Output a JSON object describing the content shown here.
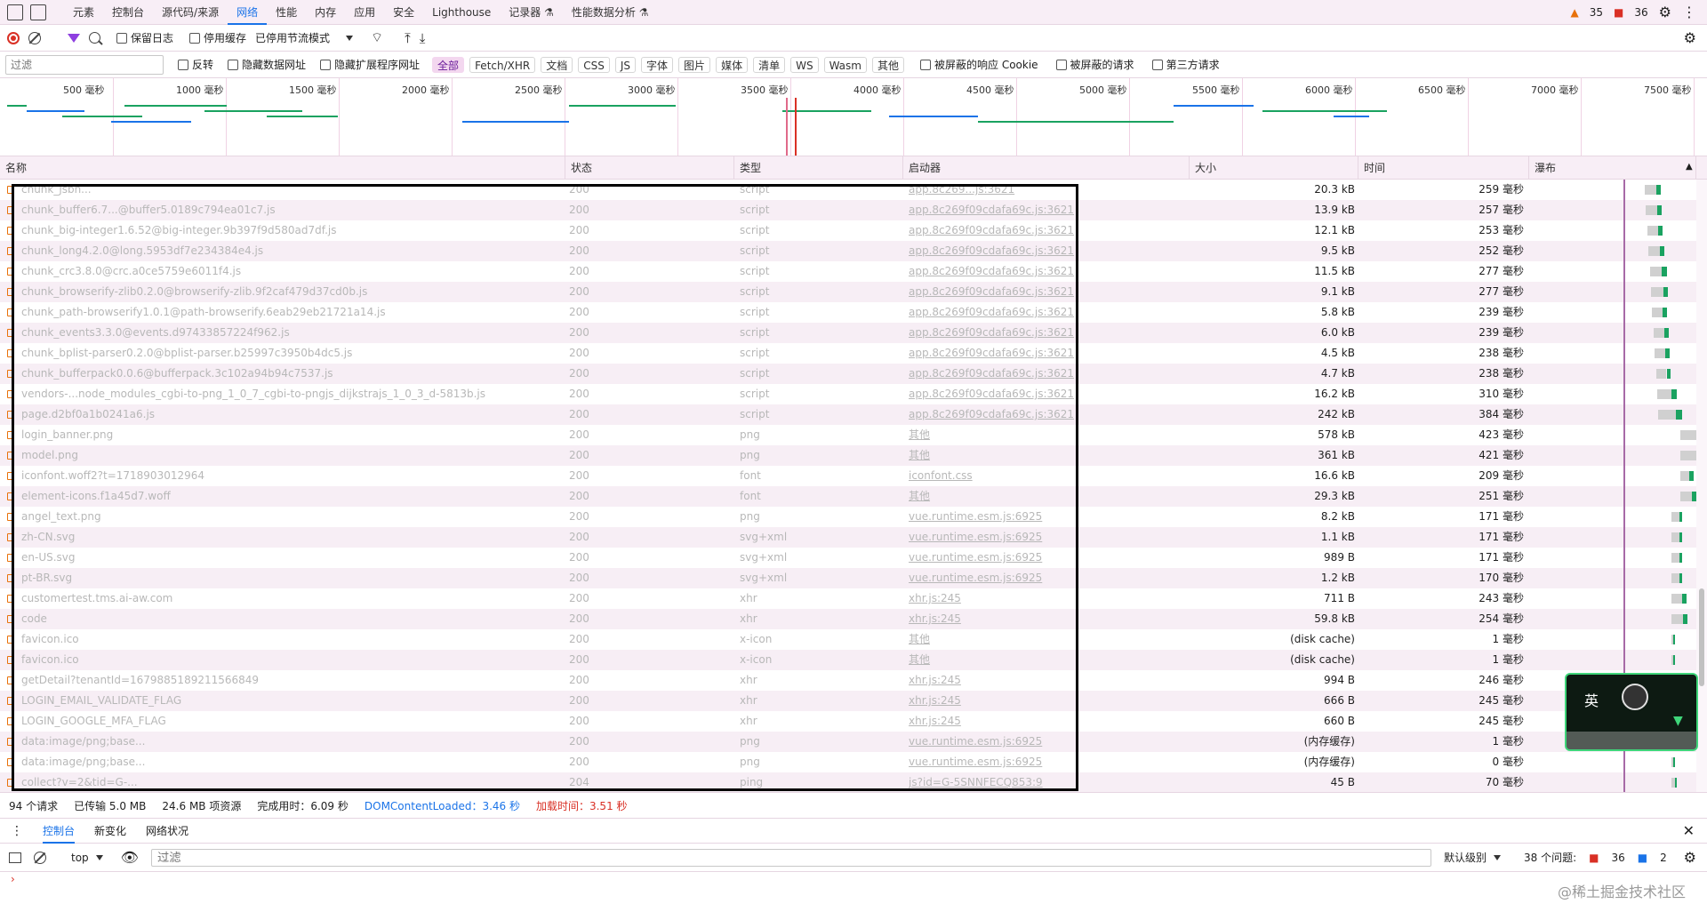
{
  "tabs": {
    "items": [
      "元素",
      "控制台",
      "源代码/来源",
      "网络",
      "性能",
      "内存",
      "应用",
      "安全",
      "Lighthouse",
      "记录器 ⚗",
      "性能数据分析 ⚗"
    ],
    "warnings": "35",
    "errors": "36"
  },
  "toolbar": {
    "preserve_log": "保留日志",
    "disable_cache": "停用缓存",
    "throttling": "已停用节流模式"
  },
  "filter": {
    "placeholder": "过滤",
    "invert": "反转",
    "hide_data_urls": "隐藏数据网址",
    "hide_ext_urls": "隐藏扩展程序网址",
    "types": [
      "全部",
      "Fetch/XHR",
      "文档",
      "CSS",
      "JS",
      "字体",
      "图片",
      "媒体",
      "清单",
      "WS",
      "Wasm",
      "其他"
    ],
    "blocked_cookies": "被屏蔽的响应 Cookie",
    "blocked_requests": "被屏蔽的请求",
    "third_party": "第三方请求"
  },
  "overview": {
    "ticks": [
      "500 毫秒",
      "1000 毫秒",
      "1500 毫秒",
      "2000 毫秒",
      "2500 毫秒",
      "3000 毫秒",
      "3500 毫秒",
      "4000 毫秒",
      "4500 毫秒",
      "5000 毫秒",
      "5500 毫秒",
      "6000 毫秒",
      "6500 毫秒",
      "7000 毫秒",
      "7500 毫秒"
    ]
  },
  "columns": {
    "name": "名称",
    "status": "状态",
    "type": "类型",
    "initiator": "启动器",
    "size": "大小",
    "time": "时间",
    "waterfall": "瀑布"
  },
  "rows": [
    {
      "name": "chunk_jsbn...",
      "status": "200",
      "type": "script",
      "initiator": "app.8c269...js:3621",
      "size": "20.3 kB",
      "time": "259 毫秒"
    },
    {
      "name": "chunk_buffer6.7...@buffer5.0189c794ea01c7.js",
      "status": "200",
      "type": "script",
      "initiator": "app.8c269f09cdafa69c.js:3621",
      "size": "13.9 kB",
      "time": "257 毫秒"
    },
    {
      "name": "chunk_big-integer1.6.52@big-integer.9b397f9d580ad7df.js",
      "status": "200",
      "type": "script",
      "initiator": "app.8c269f09cdafa69c.js:3621",
      "size": "12.1 kB",
      "time": "253 毫秒"
    },
    {
      "name": "chunk_long4.2.0@long.5953df7e234384e4.js",
      "status": "200",
      "type": "script",
      "initiator": "app.8c269f09cdafa69c.js:3621",
      "size": "9.5 kB",
      "time": "252 毫秒"
    },
    {
      "name": "chunk_crc3.8.0@crc.a0ce5759e6011f4.js",
      "status": "200",
      "type": "script",
      "initiator": "app.8c269f09cdafa69c.js:3621",
      "size": "11.5 kB",
      "time": "277 毫秒"
    },
    {
      "name": "chunk_browserify-zlib0.2.0@browserify-zlib.9f2caf479d37cd0b.js",
      "status": "200",
      "type": "script",
      "initiator": "app.8c269f09cdafa69c.js:3621",
      "size": "9.1 kB",
      "time": "277 毫秒"
    },
    {
      "name": "chunk_path-browserify1.0.1@path-browserify.6eab29eb21721a14.js",
      "status": "200",
      "type": "script",
      "initiator": "app.8c269f09cdafa69c.js:3621",
      "size": "5.8 kB",
      "time": "239 毫秒"
    },
    {
      "name": "chunk_events3.3.0@events.d97433857224f962.js",
      "status": "200",
      "type": "script",
      "initiator": "app.8c269f09cdafa69c.js:3621",
      "size": "6.0 kB",
      "time": "239 毫秒"
    },
    {
      "name": "chunk_bplist-parser0.2.0@bplist-parser.b25997c3950b4dc5.js",
      "status": "200",
      "type": "script",
      "initiator": "app.8c269f09cdafa69c.js:3621",
      "size": "4.5 kB",
      "time": "238 毫秒"
    },
    {
      "name": "chunk_bufferpack0.0.6@bufferpack.3c102a94b94c7537.js",
      "status": "200",
      "type": "script",
      "initiator": "app.8c269f09cdafa69c.js:3621",
      "size": "4.7 kB",
      "time": "238 毫秒"
    },
    {
      "name": "vendors-...node_modules_cgbi-to-png_1_0_7_cgbi-to-pngjs_dijkstrajs_1_0_3_d-5813b.js",
      "status": "200",
      "type": "script",
      "initiator": "app.8c269f09cdafa69c.js:3621",
      "size": "16.2 kB",
      "time": "310 毫秒"
    },
    {
      "name": "page.d2bf0a1b0241a6.js",
      "status": "200",
      "type": "script",
      "initiator": "app.8c269f09cdafa69c.js:3621",
      "size": "242 kB",
      "time": "384 毫秒"
    },
    {
      "name": "login_banner.png",
      "status": "200",
      "type": "png",
      "initiator": "其他",
      "size": "578 kB",
      "time": "423 毫秒"
    },
    {
      "name": "model.png",
      "status": "200",
      "type": "png",
      "initiator": "其他",
      "size": "361 kB",
      "time": "421 毫秒"
    },
    {
      "name": "iconfont.woff2?t=1718903012964",
      "status": "200",
      "type": "font",
      "initiator": "iconfont.css",
      "size": "16.6 kB",
      "time": "209 毫秒"
    },
    {
      "name": "element-icons.f1a45d7.woff",
      "status": "200",
      "type": "font",
      "initiator": "其他",
      "size": "29.3 kB",
      "time": "251 毫秒"
    },
    {
      "name": "angel_text.png",
      "status": "200",
      "type": "png",
      "initiator": "vue.runtime.esm.js:6925",
      "size": "8.2 kB",
      "time": "171 毫秒"
    },
    {
      "name": "zh-CN.svg",
      "status": "200",
      "type": "svg+xml",
      "initiator": "vue.runtime.esm.js:6925",
      "size": "1.1 kB",
      "time": "171 毫秒"
    },
    {
      "name": "en-US.svg",
      "status": "200",
      "type": "svg+xml",
      "initiator": "vue.runtime.esm.js:6925",
      "size": "989 B",
      "time": "171 毫秒"
    },
    {
      "name": "pt-BR.svg",
      "status": "200",
      "type": "svg+xml",
      "initiator": "vue.runtime.esm.js:6925",
      "size": "1.2 kB",
      "time": "170 毫秒"
    },
    {
      "name": "customertest.tms.ai-aw.com",
      "status": "200",
      "type": "xhr",
      "initiator": "xhr.js:245",
      "size": "711 B",
      "time": "243 毫秒"
    },
    {
      "name": "code",
      "status": "200",
      "type": "xhr",
      "initiator": "xhr.js:245",
      "size": "59.8 kB",
      "time": "254 毫秒"
    },
    {
      "name": "favicon.ico",
      "status": "200",
      "type": "x-icon",
      "initiator": "其他",
      "size": "(disk cache)",
      "time": "1 毫秒"
    },
    {
      "name": "favicon.ico",
      "status": "200",
      "type": "x-icon",
      "initiator": "其他",
      "size": "(disk cache)",
      "time": "1 毫秒"
    },
    {
      "name": "getDetail?tenantId=1679885189211566849",
      "status": "200",
      "type": "xhr",
      "initiator": "xhr.js:245",
      "size": "994 B",
      "time": "246 毫秒"
    },
    {
      "name": "LOGIN_EMAIL_VALIDATE_FLAG",
      "status": "200",
      "type": "xhr",
      "initiator": "xhr.js:245",
      "size": "666 B",
      "time": "245 毫秒"
    },
    {
      "name": "LOGIN_GOOGLE_MFA_FLAG",
      "status": "200",
      "type": "xhr",
      "initiator": "xhr.js:245",
      "size": "660 B",
      "time": "245 毫秒"
    },
    {
      "name": "data:image/png;base...",
      "status": "200",
      "type": "png",
      "initiator": "vue.runtime.esm.js:6925",
      "size": "(内存缓存)",
      "time": "1 毫秒"
    },
    {
      "name": "data:image/png;base...",
      "status": "200",
      "type": "png",
      "initiator": "vue.runtime.esm.js:6925",
      "size": "(内存缓存)",
      "time": "0 毫秒"
    },
    {
      "name": "collect?v=2&tid=G-...",
      "status": "204",
      "type": "ping",
      "initiator": "js?id=G-5SNNFECQ853:9",
      "size": "45 B",
      "time": "70 毫秒"
    }
  ],
  "status": {
    "requests": "94 个请求",
    "transferred": "已传输 5.0 MB",
    "resources": "24.6 MB 项资源",
    "finish": "完成用时：6.09 秒",
    "dcl": "DOMContentLoaded：3.46 秒",
    "load": "加载时间：3.51 秒"
  },
  "drawer": {
    "tabs": [
      "控制台",
      "新变化",
      "网络状况"
    ]
  },
  "console": {
    "context": "top",
    "filter_placeholder": "过滤",
    "level": "默认级别",
    "issues": "38 个问题:",
    "issue_errors": "36",
    "issue_info": "2"
  },
  "widget": {
    "label": "英"
  },
  "watermark": "@稀土掘金技术社区",
  "colors": {
    "accent": "#1a73e8",
    "record": "#d93025",
    "warning": "#e8710a",
    "waterfall_green": "#1aa260",
    "waterfall_blue": "#1a73e8"
  }
}
